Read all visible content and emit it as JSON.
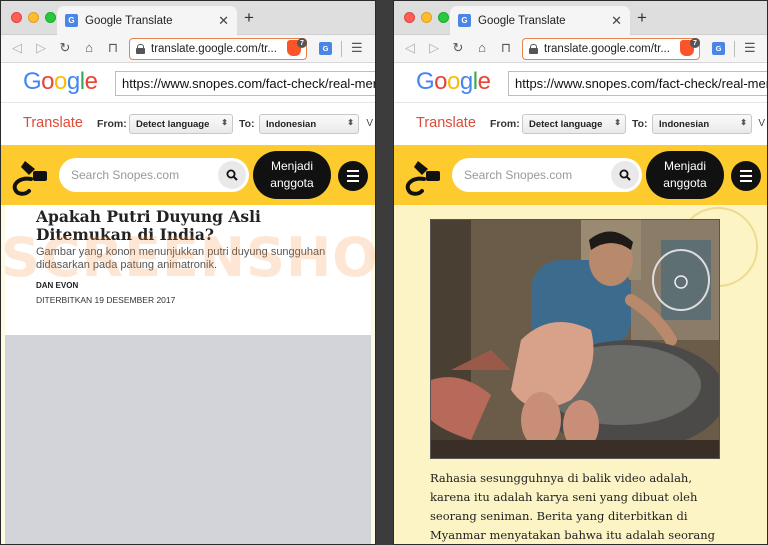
{
  "tab": {
    "title": "Google Translate",
    "favicon_label": "G"
  },
  "address": {
    "text": "translate.google.com/tr..."
  },
  "brave": {
    "badge": "7"
  },
  "extension": {
    "label": "G"
  },
  "google": {
    "logo_letters": [
      "G",
      "o",
      "o",
      "g",
      "l",
      "e"
    ],
    "logo_colors": [
      "#4285F4",
      "#EA4335",
      "#FBBC05",
      "#4285F4",
      "#34A853",
      "#EA4335"
    ],
    "url_value": "https://www.snopes.com/fact-check/real-mermaid-india/"
  },
  "translate": {
    "name": "Translate",
    "from_label": "From:",
    "from_value": "Detect language",
    "to_label": "To:",
    "to_value": "Indonesian",
    "more": "V"
  },
  "snopes": {
    "search_placeholder": "Search Snopes.com",
    "join_line1": "Menjadi",
    "join_line2": "anggota"
  },
  "article": {
    "title": "Apakah Putri Duyung Asli Ditemukan di India?",
    "subtitle": "Gambar yang konon menunjukkan putri duyung sungguhan didasarkan pada patung animatronik.",
    "author": "DAN EVON",
    "date": "DITERBITKAN 19 DESEMBER 2017",
    "body": "Rahasia sesungguhnya di balik video adalah, karena itu adalah karya seni yang dibuat oleh seorang seniman. Berita yang diterbitkan di Myanmar menyatakan bahwa itu adalah seorang seniman dari"
  },
  "watermark": "SCREENSHOT",
  "colors": {
    "snopes_yellow": "#fecb2f",
    "translate_red": "#dd4b39",
    "address_border": "#e8834b",
    "page_bg": "#fdf4c6"
  },
  "icons": {
    "back": "arrow-left-icon",
    "forward": "arrow-right-icon",
    "reload": "reload-icon",
    "home": "home-icon",
    "bookmark": "bookmark-icon",
    "lock": "lock-icon",
    "menu": "hamburger-icon",
    "search": "search-icon"
  }
}
